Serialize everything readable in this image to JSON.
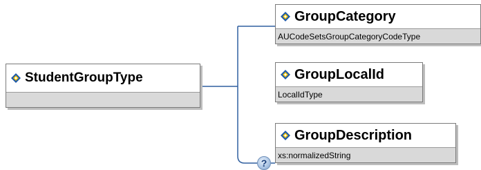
{
  "root": {
    "name": "StudentGroupType",
    "type": ""
  },
  "children": [
    {
      "name": "GroupCategory",
      "type": "AUCodeSetsGroupCategoryCodeType"
    },
    {
      "name": "GroupLocalId",
      "type": "LocalIdType"
    },
    {
      "name": "GroupDescription",
      "type": "xs:normalizedString",
      "optional_marker": "?"
    }
  ],
  "colors": {
    "connector": "#2f5f9f",
    "box_border": "#7a7a7a",
    "type_band": "#d9d9d9",
    "icon_blue": "#1f5aa8",
    "icon_yellow": "#f2c200"
  },
  "icons": {
    "element": "element-icon"
  }
}
